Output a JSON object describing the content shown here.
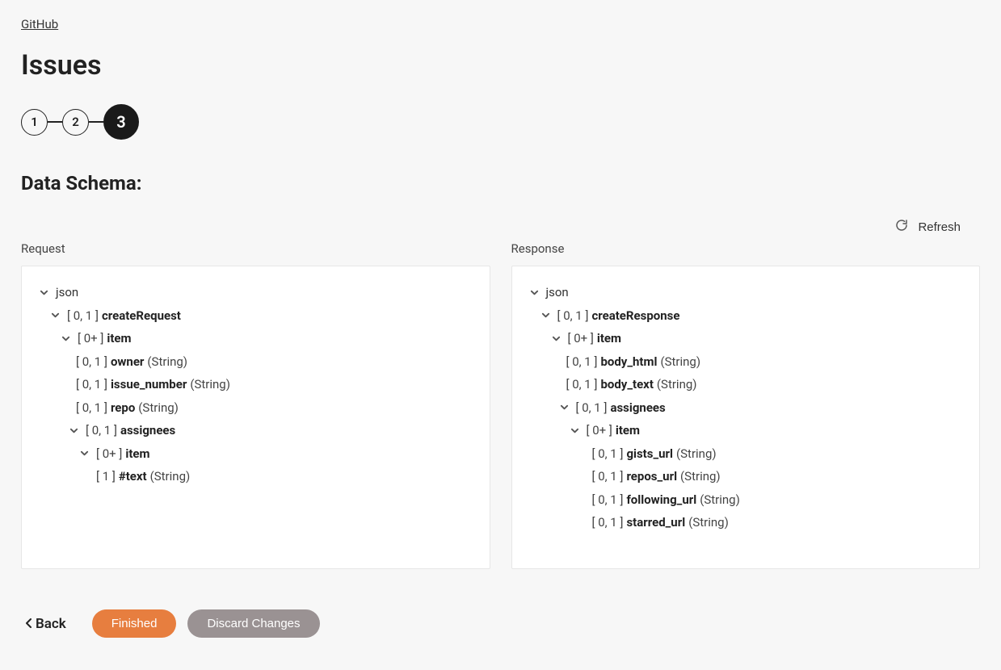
{
  "breadcrumb": {
    "label": "GitHub"
  },
  "page_title": "Issues",
  "stepper": {
    "steps": [
      "1",
      "2",
      "3"
    ],
    "active_index": 2
  },
  "section_heading": "Data Schema:",
  "refresh_label": "Refresh",
  "panels": {
    "request": {
      "label": "Request",
      "tree": [
        {
          "indent": 0,
          "chevron": true,
          "card": "",
          "name": "json",
          "name_bold": false,
          "type": ""
        },
        {
          "indent": 1,
          "chevron": true,
          "card": "[ 0, 1 ]",
          "name": "createRequest",
          "name_bold": true,
          "type": ""
        },
        {
          "indent": 2,
          "chevron": true,
          "card": "[ 0+ ]",
          "name": "item",
          "name_bold": true,
          "type": ""
        },
        {
          "indent": 3,
          "chevron": false,
          "card": "[ 0, 1 ]",
          "name": "owner",
          "name_bold": true,
          "type": "(String)"
        },
        {
          "indent": 3,
          "chevron": false,
          "card": "[ 0, 1 ]",
          "name": "issue_number",
          "name_bold": true,
          "type": "(String)"
        },
        {
          "indent": 3,
          "chevron": false,
          "card": "[ 0, 1 ]",
          "name": "repo",
          "name_bold": true,
          "type": "(String)"
        },
        {
          "indent": 3,
          "chevron": true,
          "chev_offset": true,
          "card": "[ 0, 1 ]",
          "name": "assignees",
          "name_bold": true,
          "type": ""
        },
        {
          "indent": 4,
          "chevron": true,
          "chev_offset": true,
          "card": "[ 0+ ]",
          "name": "item",
          "name_bold": true,
          "type": ""
        },
        {
          "indent": 5,
          "chevron": false,
          "card": "[ 1 ]",
          "name": "#text",
          "name_bold": true,
          "type": "(String)"
        }
      ]
    },
    "response": {
      "label": "Response",
      "tree": [
        {
          "indent": 0,
          "chevron": true,
          "card": "",
          "name": "json",
          "name_bold": false,
          "type": ""
        },
        {
          "indent": 1,
          "chevron": true,
          "card": "[ 0, 1 ]",
          "name": "createResponse",
          "name_bold": true,
          "type": ""
        },
        {
          "indent": 2,
          "chevron": true,
          "card": "[ 0+ ]",
          "name": "item",
          "name_bold": true,
          "type": ""
        },
        {
          "indent": 3,
          "chevron": false,
          "card": "[ 0, 1 ]",
          "name": "body_html",
          "name_bold": true,
          "type": "(String)"
        },
        {
          "indent": 3,
          "chevron": false,
          "card": "[ 0, 1 ]",
          "name": "body_text",
          "name_bold": true,
          "type": "(String)"
        },
        {
          "indent": 3,
          "chevron": true,
          "chev_offset": true,
          "card": "[ 0, 1 ]",
          "name": "assignees",
          "name_bold": true,
          "type": ""
        },
        {
          "indent": 4,
          "chevron": true,
          "chev_offset": true,
          "card": "[ 0+ ]",
          "name": "item",
          "name_bold": true,
          "type": ""
        },
        {
          "indent": 5,
          "chevron": false,
          "chev_pad": true,
          "card": "[ 0, 1 ]",
          "name": "gists_url",
          "name_bold": true,
          "type": "(String)"
        },
        {
          "indent": 5,
          "chevron": false,
          "chev_pad": true,
          "card": "[ 0, 1 ]",
          "name": "repos_url",
          "name_bold": true,
          "type": "(String)"
        },
        {
          "indent": 5,
          "chevron": false,
          "chev_pad": true,
          "card": "[ 0, 1 ]",
          "name": "following_url",
          "name_bold": true,
          "type": "(String)"
        },
        {
          "indent": 5,
          "chevron": false,
          "chev_pad": true,
          "card": "[ 0, 1 ]",
          "name": "starred_url",
          "name_bold": true,
          "type": "(String)"
        }
      ]
    }
  },
  "footer": {
    "back_label": "Back",
    "finished_label": "Finished",
    "discard_label": "Discard Changes"
  }
}
